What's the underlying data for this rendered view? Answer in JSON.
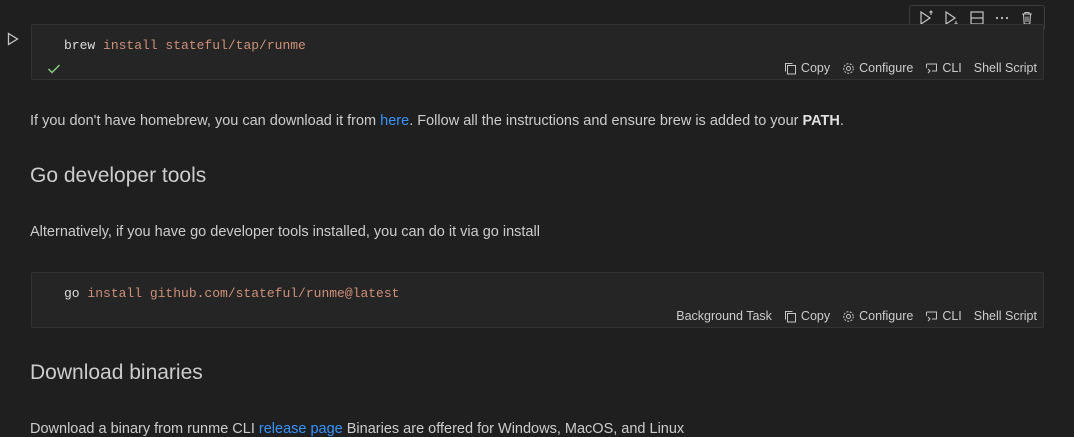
{
  "cell1": {
    "code_cmd": "brew",
    "code_args": " install stateful/tap/runme",
    "status_items": [
      {
        "icon": "copy-icon",
        "label": "Copy"
      },
      {
        "icon": "gear-icon",
        "label": "Configure"
      },
      {
        "icon": "terminal-icon",
        "label": "CLI"
      },
      {
        "label": "Shell Script"
      }
    ]
  },
  "toolbar": {
    "icons": [
      "run-above-icon",
      "run-below-icon",
      "split-cell-icon",
      "more-icon",
      "delete-icon"
    ]
  },
  "para1": {
    "before": "If you don't have homebrew, you can download it from ",
    "link": "here",
    "middle": ". Follow all the instructions and ensure brew is added to your ",
    "bold": "PATH",
    "after": "."
  },
  "heading_go": "Go developer tools",
  "para2": "Alternatively, if you have go developer tools installed, you can do it via go install",
  "cell2": {
    "code_cmd": "go",
    "code_args": " install github.com/stateful/runme@latest",
    "status_items": [
      {
        "label": "Background Task"
      },
      {
        "icon": "copy-icon",
        "label": "Copy"
      },
      {
        "icon": "gear-icon",
        "label": "Configure"
      },
      {
        "icon": "terminal-icon",
        "label": "CLI"
      },
      {
        "label": "Shell Script"
      }
    ]
  },
  "heading_bin": "Download binaries",
  "para3": {
    "before": "Download a binary from runme CLI ",
    "link": "release page",
    "after": " Binaries are offered for Windows, MacOS, and Linux"
  },
  "colors": {
    "background": "#1f1f1f",
    "cell_bg": "#252526",
    "link": "#3794ff",
    "string": "#ce9178",
    "success": "#89d185"
  }
}
